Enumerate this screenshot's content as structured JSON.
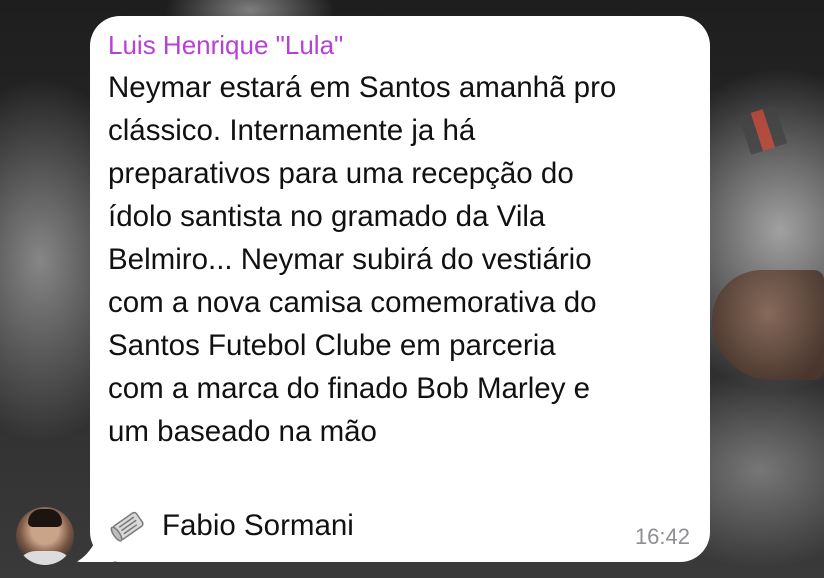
{
  "message": {
    "sender_name": "Luis Henrique \"Lula\"",
    "sender_color": "#b840d6",
    "lines": [
      "Neymar estará em Santos amanhã pro",
      "clássico. Internamente ja há",
      "preparativos para uma recepção do",
      "ídolo santista no gramado da Vila",
      "Belmiro... Neymar subirá do vestiário",
      "com a nova camisa comemorativa do",
      "Santos Futebol Clube em parceria",
      "com a marca do finado Bob Marley e",
      "um baseado na mão"
    ],
    "forward_icon": "newspaper-roll-icon",
    "forward_name": "Fabio Sormani",
    "time": "16:42"
  }
}
